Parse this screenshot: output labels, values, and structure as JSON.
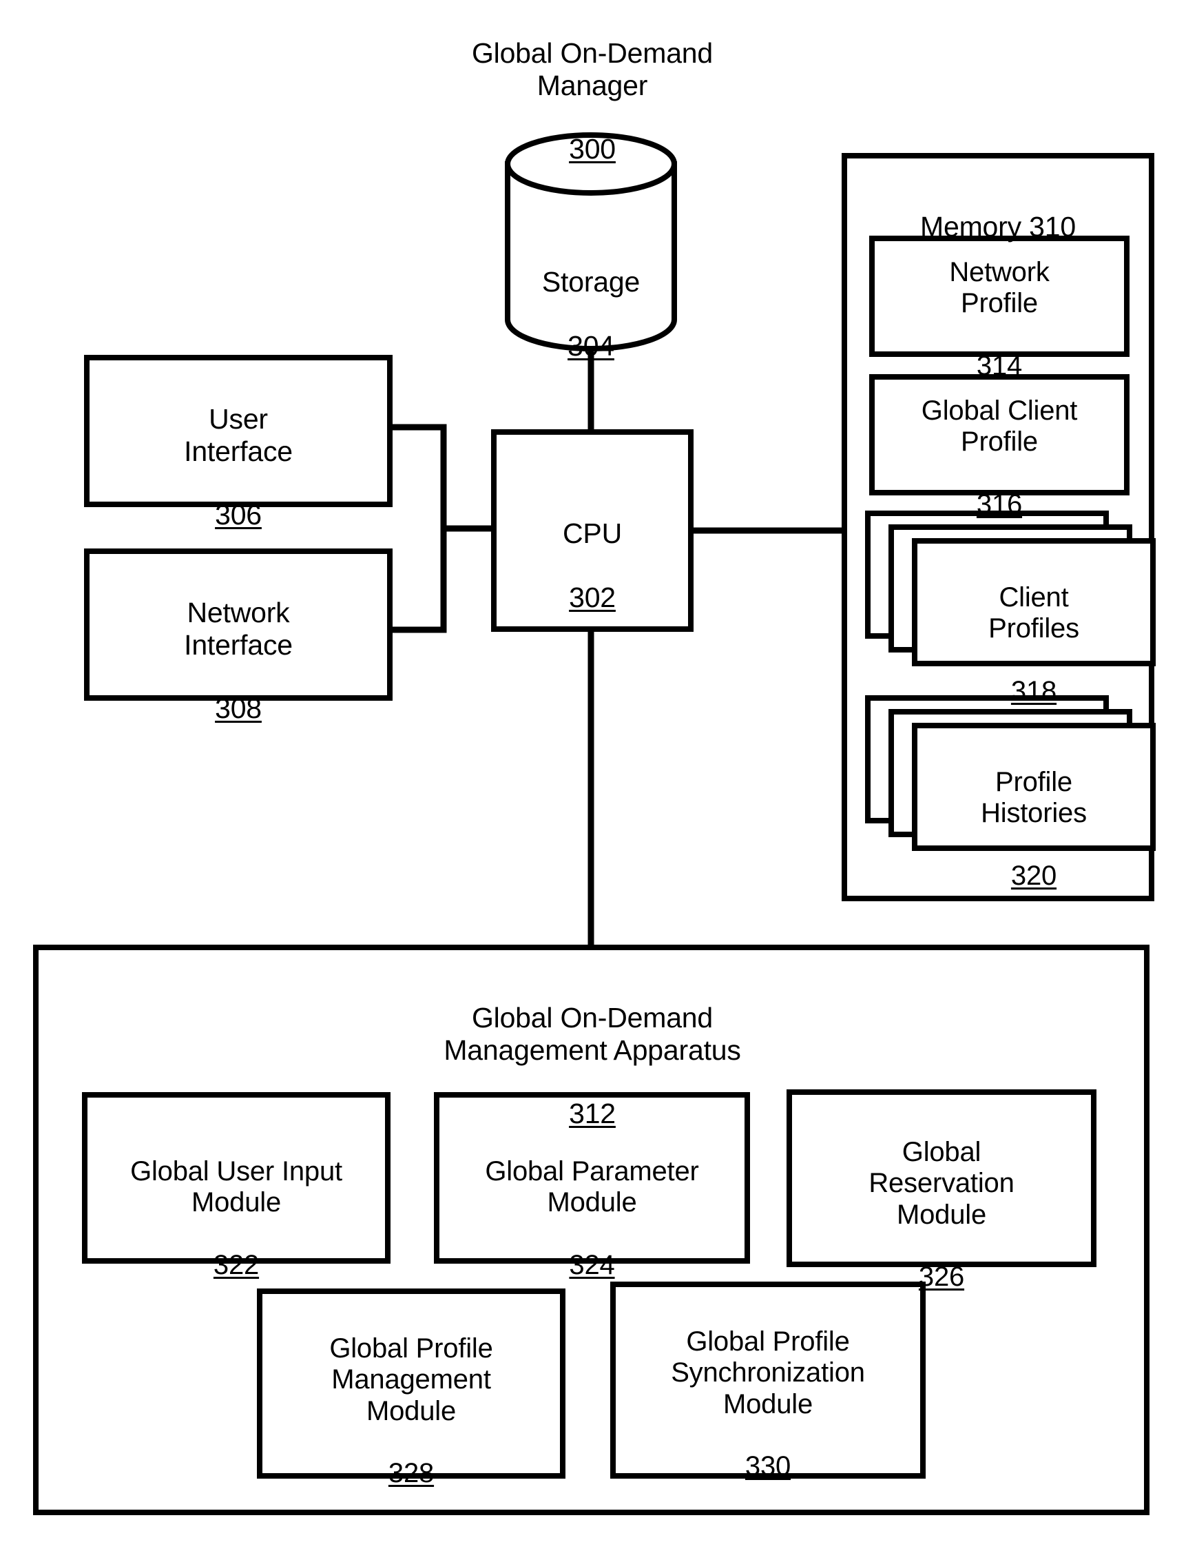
{
  "figure": {
    "title": {
      "text": "Global On-Demand\nManager",
      "ref": "300"
    },
    "storage": {
      "label": "Storage",
      "ref": "304"
    },
    "cpu": {
      "label": "CPU",
      "ref": "302"
    },
    "user_interface": {
      "label": "User\nInterface",
      "ref": "306"
    },
    "network_interface": {
      "label": "Network\nInterface",
      "ref": "308"
    },
    "memory": {
      "label": "Memory",
      "ref": "310",
      "items": [
        {
          "label": "Network\nProfile",
          "ref": "314",
          "stacked": false
        },
        {
          "label": "Global Client\nProfile",
          "ref": "316",
          "stacked": false
        },
        {
          "label": "Client\nProfiles",
          "ref": "318",
          "stacked": true
        },
        {
          "label": "Profile\nHistories",
          "ref": "320",
          "stacked": true
        }
      ]
    },
    "apparatus": {
      "title": "Global On-Demand\nManagement Apparatus",
      "ref": "312",
      "modules": [
        {
          "label": "Global User Input\nModule",
          "ref": "322"
        },
        {
          "label": "Global Parameter\nModule",
          "ref": "324"
        },
        {
          "label": "Global\nReservation\nModule",
          "ref": "326"
        },
        {
          "label": "Global Profile\nManagement\nModule",
          "ref": "328"
        },
        {
          "label": "Global Profile\nSynchronization\nModule",
          "ref": "330"
        }
      ]
    },
    "colors": {
      "stroke": "#000000",
      "background": "#ffffff"
    }
  }
}
